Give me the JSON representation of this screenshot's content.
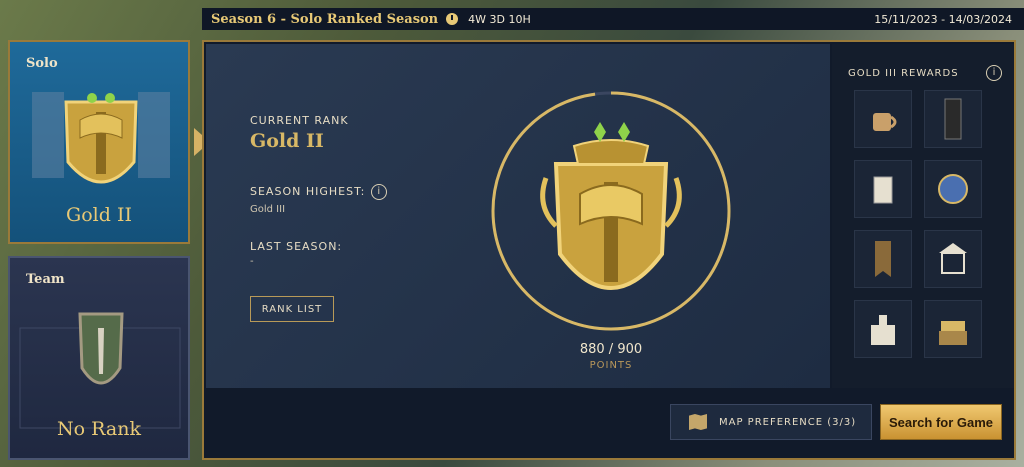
{
  "header": {
    "season_title": "Season 6 - Solo Ranked Season",
    "time_left": "4W 3D 10H",
    "season_dates": "15/11/2023 - 14/03/2024"
  },
  "mode_cards": [
    {
      "label": "Solo",
      "rank": "Gold II",
      "selected": true
    },
    {
      "label": "Team",
      "rank": "No Rank",
      "selected": false
    }
  ],
  "rank_panel": {
    "current_rank_label": "CURRENT RANK",
    "current_rank": "Gold II",
    "season_highest_label": "SEASON HIGHEST:",
    "season_highest": "Gold III",
    "last_season_label": "LAST SEASON:",
    "last_season": "-",
    "rank_list_label": "RANK LIST",
    "points": "880 / 900",
    "points_label": "POINTS",
    "progress_fraction": 0.978
  },
  "rewards": {
    "title": "GOLD III REWARDS",
    "items": [
      "mug-icon",
      "card-icon",
      "lantern-icon",
      "emblem-icon",
      "banner-icon",
      "carousel-icon",
      "castle-icon",
      "treasure-icon"
    ]
  },
  "actions": {
    "map_preference": "MAP PREFERENCE (3/3)",
    "search": "Search for Game"
  },
  "colors": {
    "gold": "#e8c976",
    "accent": "#d8b866",
    "solo_card": "#1f6a9a"
  }
}
